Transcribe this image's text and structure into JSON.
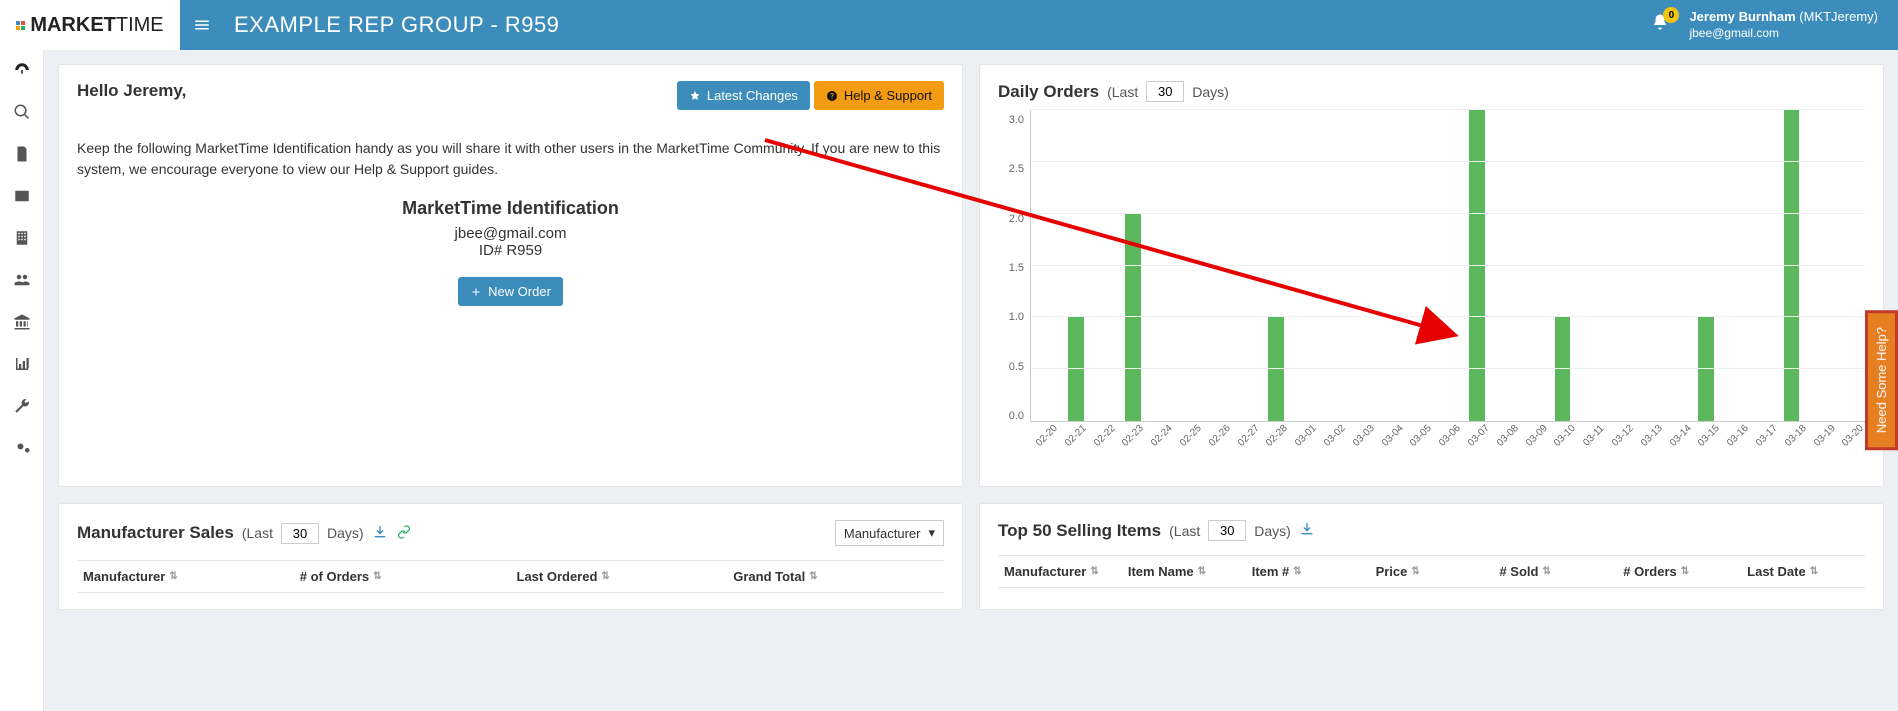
{
  "header": {
    "brand_prefix": "MARKET",
    "brand_suffix": "TIME",
    "rep_group_title": "EXAMPLE REP GROUP - R959",
    "bell_count": "0",
    "user_name": "Jeremy Burnham",
    "user_alias": "(MKTJeremy)",
    "user_email": "jbee@gmail.com"
  },
  "welcome": {
    "hello": "Hello Jeremy,",
    "latest_btn": "Latest Changes",
    "help_btn": "Help & Support",
    "body": "Keep the following MarketTime Identification handy as you will share it with other users in the MarketTime Community. If you are new to this system, we encourage everyone to view our Help & Support guides.",
    "id_title": "MarketTime Identification",
    "id_email": "jbee@gmail.com",
    "id_number": "ID# R959",
    "new_order_btn": "New Order"
  },
  "daily_orders": {
    "title": "Daily Orders",
    "sub_prefix": "(Last",
    "days_value": "30",
    "sub_suffix": "Days)"
  },
  "chart_data": {
    "type": "bar",
    "title": "Daily Orders (Last 30 Days)",
    "xlabel": "",
    "ylabel": "",
    "ylim": [
      0,
      3
    ],
    "yticks": [
      0,
      0.5,
      1.0,
      1.5,
      2.0,
      2.5,
      3.0
    ],
    "categories": [
      "02-20",
      "02-21",
      "02-22",
      "02-23",
      "02-24",
      "02-25",
      "02-26",
      "02-27",
      "02-28",
      "03-01",
      "03-02",
      "03-03",
      "03-04",
      "03-05",
      "03-06",
      "03-07",
      "03-08",
      "03-09",
      "03-10",
      "03-11",
      "03-12",
      "03-13",
      "03-14",
      "03-15",
      "03-16",
      "03-17",
      "03-18",
      "03-19",
      "03-20"
    ],
    "values": [
      0,
      1,
      0,
      2,
      0,
      0,
      0,
      0,
      1,
      0,
      0,
      0,
      0,
      0,
      0,
      3,
      0,
      0,
      1,
      0,
      0,
      0,
      0,
      1,
      0,
      0,
      3,
      0,
      0
    ]
  },
  "mfr_sales": {
    "title": "Manufacturer Sales",
    "sub_prefix": "(Last",
    "days_value": "30",
    "sub_suffix": "Days)",
    "select_label": "Manufacturer",
    "cols": [
      "Manufacturer",
      "# of Orders",
      "Last Ordered",
      "Grand Total"
    ]
  },
  "top_items": {
    "title": "Top 50 Selling Items",
    "sub_prefix": "(Last",
    "days_value": "30",
    "sub_suffix": "Days)",
    "cols": [
      "Manufacturer",
      "Item Name",
      "Item #",
      "Price",
      "# Sold",
      "# Orders",
      "Last Date"
    ]
  },
  "help_tab": "Need Some Help?"
}
